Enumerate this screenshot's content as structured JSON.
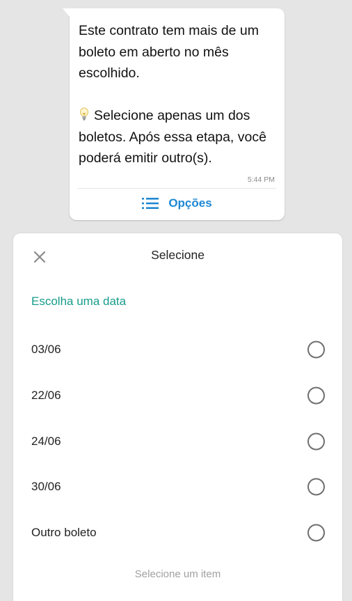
{
  "message": {
    "line1": "Este contrato tem mais de um boleto em aberto no mês escolhido.",
    "line2": "Selecione apenas um dos boletos. Após essa etapa, você poderá emitir outro(s).",
    "icon": "lightbulb-icon",
    "time": "5:44 PM",
    "options_label": "Opções"
  },
  "sheet": {
    "title": "Selecione",
    "section_label": "Escolha uma data",
    "options": [
      {
        "label": "03/06",
        "selected": false
      },
      {
        "label": "22/06",
        "selected": false
      },
      {
        "label": "24/06",
        "selected": false
      },
      {
        "label": "30/06",
        "selected": false
      },
      {
        "label": "Outro boleto",
        "selected": false
      }
    ],
    "hint": "Selecione um item"
  },
  "colors": {
    "accent_blue": "#1e88d3",
    "accent_teal": "#169c8a",
    "background": "#e5e5e5"
  }
}
